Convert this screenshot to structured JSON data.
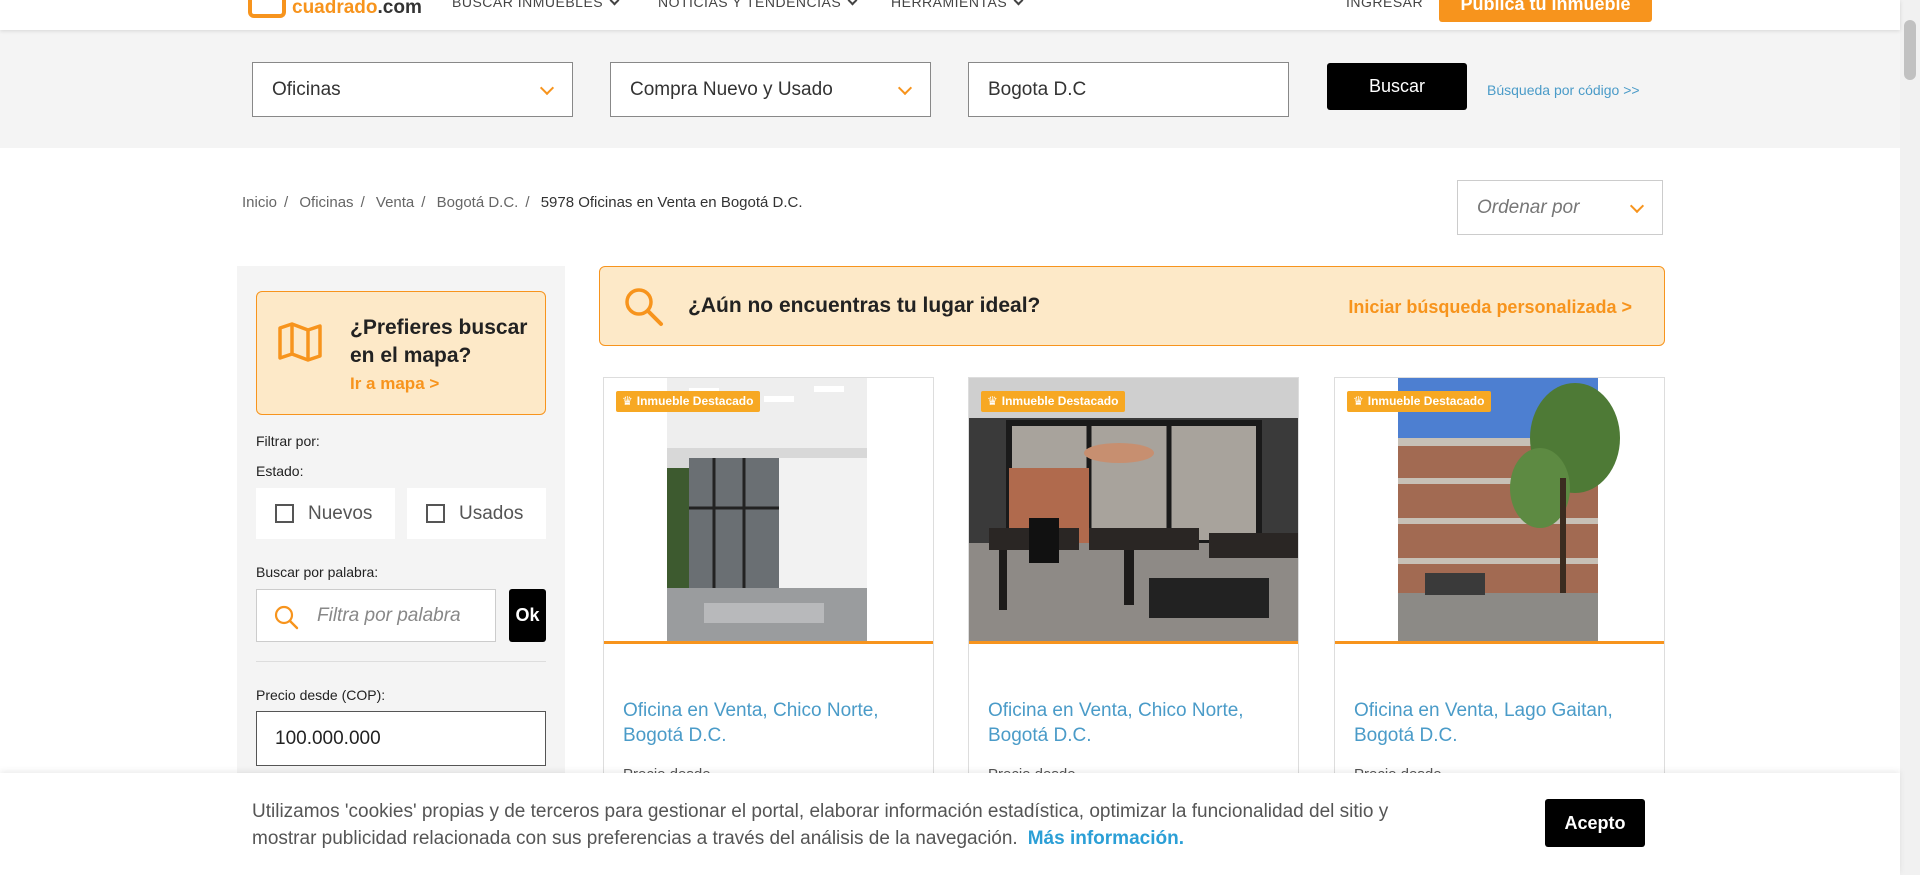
{
  "brand": {
    "logo_text_prefix": "",
    "logo_text_main": "cuadrado",
    "logo_text_suffix": ".com",
    "accent_color": "#f7941d"
  },
  "nav": {
    "items": [
      "BUSCAR INMUEBLES",
      "NOTICIAS Y TENDENCIAS",
      "HERRAMIENTAS"
    ],
    "login": "INGRESAR",
    "publish": "Publica tu inmueble"
  },
  "search": {
    "property_type": "Oficinas",
    "operation": "Compra Nuevo y Usado",
    "location": "Bogota D.C",
    "button": "Buscar",
    "code_link": "Búsqueda por código >>"
  },
  "breadcrumb": {
    "items": [
      "Inicio",
      "Oficinas",
      "Venta",
      "Bogotá D.C."
    ],
    "current": "5978 Oficinas en Venta en Bogotá D.C."
  },
  "sort": {
    "placeholder": "Ordenar por"
  },
  "sidebar": {
    "map_title": "¿Prefieres buscar en el mapa?",
    "map_link": "Ir a mapa >",
    "filter_label": "Filtrar por:",
    "state_label": "Estado:",
    "state_options": [
      "Nuevos",
      "Usados"
    ],
    "word_label": "Buscar por palabra:",
    "word_placeholder": "Filtra por palabra",
    "ok_button": "Ok",
    "price_label": "Precio desde (COP):",
    "price_value": "100.000.000"
  },
  "banner": {
    "title": "¿Aún no encuentras tu lugar ideal?",
    "link": "Iniciar búsqueda personalizada >"
  },
  "cards": [
    {
      "badge": "Inmueble Destacado",
      "title": "Oficina en Venta, Chico Norte, Bogotá D.C.",
      "sub": "Precio desde"
    },
    {
      "badge": "Inmueble Destacado",
      "title": "Oficina en Venta, Chico Norte, Bogotá D.C.",
      "sub": "Precio desde"
    },
    {
      "badge": "Inmueble Destacado",
      "title": "Oficina en Venta, Lago Gaitan, Bogotá D.C.",
      "sub": "Precio desde"
    }
  ],
  "cookies": {
    "text": "Utilizamos 'cookies' propias y de terceros para gestionar el portal, elaborar información estadística, optimizar la funcionalidad del sitio y mostrar publicidad relacionada con sus preferencias a través del análisis de la navegación.",
    "more": "Más información.",
    "accept": "Acepto"
  }
}
